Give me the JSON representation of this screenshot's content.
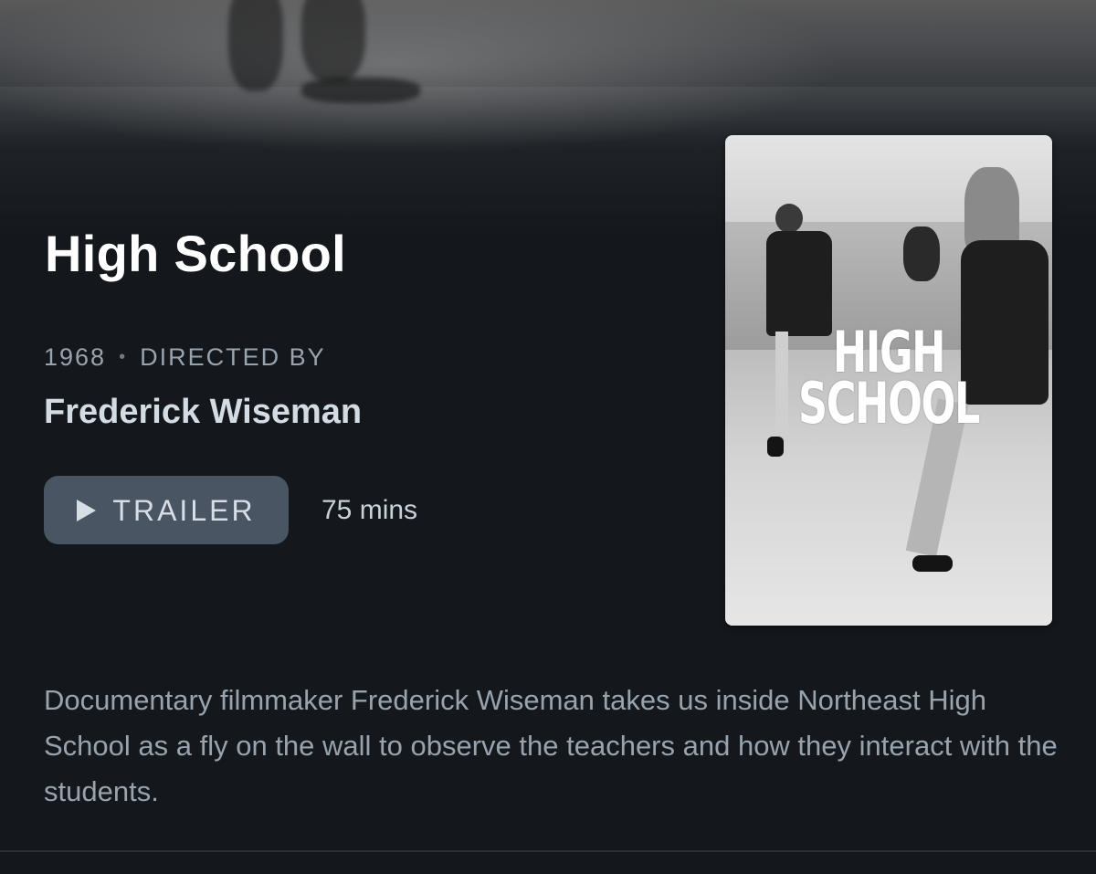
{
  "film": {
    "title": "High School",
    "year": "1968",
    "separator": "•",
    "directed_by_label": "DIRECTED BY",
    "director": "Frederick Wiseman",
    "runtime": "75 mins",
    "description": "Documentary filmmaker Frederick Wiseman takes us inside Northeast High School as a fly on the wall to observe the teachers and how they interact with the students."
  },
  "actions": {
    "trailer_label": "TRAILER",
    "trailer_icon": "play-icon"
  },
  "poster": {
    "title_line1": "HIGH",
    "title_line2": "SCHOOL"
  },
  "colors": {
    "background": "#14181c",
    "title": "#ffffff",
    "meta": "#98a3ae",
    "director": "#d3dbe3",
    "button_bg": "#4a5563"
  }
}
